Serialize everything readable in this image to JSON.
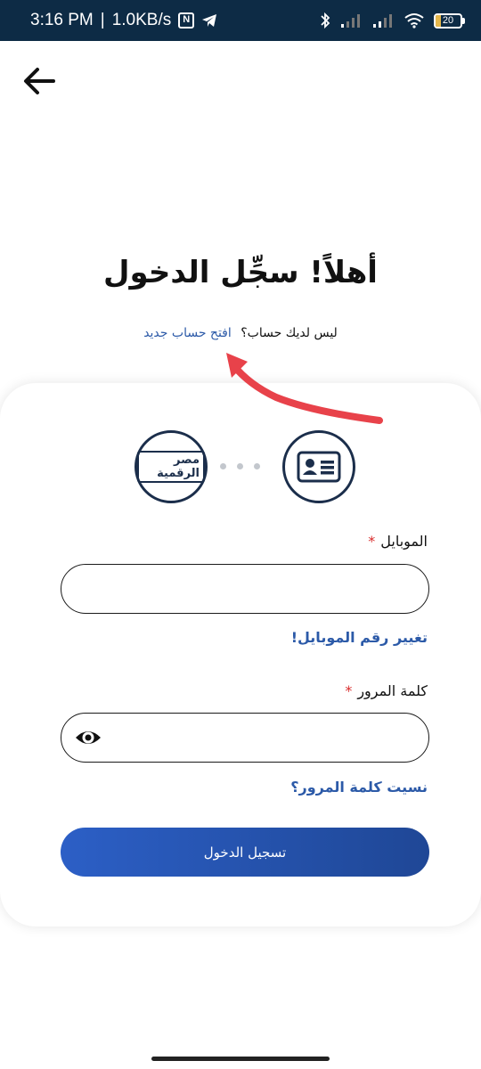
{
  "status_bar": {
    "time": "3:16 PM",
    "separator": "|",
    "net_speed": "1.0KB/s",
    "battery": "20",
    "battery_fraction": 0.2
  },
  "header": {
    "title": "أهلاً! سجِّل الدخول",
    "no_account": "ليس لديك حساب؟",
    "create_account_link": "افتح حساب جديد"
  },
  "methods": {
    "digital_label": "مصر الرقمية"
  },
  "form": {
    "mobile_label": "الموبايل",
    "required_mark": "*",
    "mobile_value": "",
    "change_mobile_link": "تغيير رقم الموبايل!",
    "password_label": "كلمة المرور",
    "password_value": "",
    "forgot_password_link": "نسيت كلمة المرور؟",
    "login_button": "تسجيل الدخول"
  },
  "colors": {
    "status_bar": "#0d2b45",
    "link": "#2c5aa8",
    "button": "#2c5fc6",
    "required": "#d92d2d",
    "annotation": "#e8424a"
  }
}
